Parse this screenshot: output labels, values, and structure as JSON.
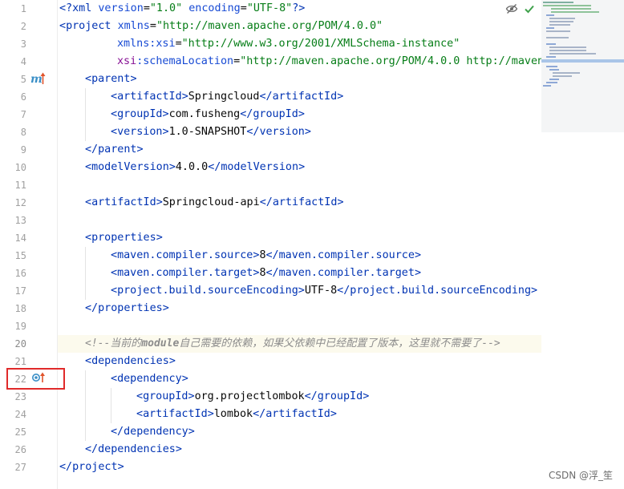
{
  "editor": {
    "line_numbers": [
      "1",
      "2",
      "3",
      "4",
      "5",
      "6",
      "7",
      "8",
      "9",
      "10",
      "11",
      "12",
      "13",
      "14",
      "15",
      "16",
      "17",
      "18",
      "19",
      "20",
      "21",
      "22",
      "23",
      "24",
      "25",
      "26",
      "27"
    ],
    "lines": {
      "l1": {
        "a": "<?",
        "b": "xml ",
        "c": "version",
        "d": "=",
        "e": "\"1.0\"",
        "f": " ",
        "g": "encoding",
        "h": "=",
        "i": "\"UTF-8\"",
        "j": "?>"
      },
      "l2": {
        "a": "<",
        "b": "project ",
        "c": "xmlns",
        "d": "=",
        "e": "\"http://maven.apache.org/POM/4.0.0\""
      },
      "l3": {
        "a": "xmlns:xsi",
        "b": "=",
        "c": "\"http://www.w3.org/2001/XMLSchema-instance\""
      },
      "l4": {
        "a": "xsi",
        "b": ":schemaLocation",
        "c": "=",
        "d": "\"http://maven.apache.org/POM/4.0.0 http://maven"
      },
      "l5": {
        "a": "<",
        "b": "parent",
        "c": ">"
      },
      "l6": {
        "a": "<",
        "b": "artifactId",
        "c": ">",
        "d": "Springcloud",
        "e": "</",
        "f": "artifactId",
        "g": ">"
      },
      "l7": {
        "a": "<",
        "b": "groupId",
        "c": ">",
        "d": "com.fusheng",
        "e": "</",
        "f": "groupId",
        "g": ">"
      },
      "l8": {
        "a": "<",
        "b": "version",
        "c": ">",
        "d": "1.0-SNAPSHOT",
        "e": "</",
        "f": "version",
        "g": ">"
      },
      "l9": {
        "a": "</",
        "b": "parent",
        "c": ">"
      },
      "l10": {
        "a": "<",
        "b": "modelVersion",
        "c": ">",
        "d": "4.0.0",
        "e": "</",
        "f": "modelVersion",
        "g": ">"
      },
      "l12": {
        "a": "<",
        "b": "artifactId",
        "c": ">",
        "d": "Springcloud-api",
        "e": "</",
        "f": "artifactId",
        "g": ">"
      },
      "l14": {
        "a": "<",
        "b": "properties",
        "c": ">"
      },
      "l15": {
        "a": "<",
        "b": "maven.compiler.source",
        "c": ">",
        "d": "8",
        "e": "</",
        "f": "maven.compiler.source",
        "g": ">"
      },
      "l16": {
        "a": "<",
        "b": "maven.compiler.target",
        "c": ">",
        "d": "8",
        "e": "</",
        "f": "maven.compiler.target",
        "g": ">"
      },
      "l17": {
        "a": "<",
        "b": "project.build.sourceEncoding",
        "c": ">",
        "d": "UTF-8",
        "e": "</",
        "f": "project.build.sourceEncoding",
        "g": ">"
      },
      "l18": {
        "a": "</",
        "b": "properties",
        "c": ">"
      },
      "l20": {
        "a": "<!--当前的",
        "b": "module",
        "c": "自己需要的依赖，如果父依赖中已经配置了版本，这里就不需要了-->"
      },
      "l21": {
        "a": "<",
        "b": "dependencies",
        "c": ">"
      },
      "l22": {
        "a": "<",
        "b": "dependency",
        "c": ">"
      },
      "l23": {
        "a": "<",
        "b": "groupId",
        "c": ">",
        "d": "org.projectlombok",
        "e": "</",
        "f": "groupId",
        "g": ">"
      },
      "l24": {
        "a": "<",
        "b": "artifactId",
        "c": ">",
        "d": "lombok",
        "e": "</",
        "f": "artifactId",
        "g": ">"
      },
      "l25": {
        "a": "</",
        "b": "dependency",
        "c": ">"
      },
      "l26": {
        "a": "</",
        "b": "dependencies",
        "c": ">"
      },
      "l27": {
        "a": "</",
        "b": "project",
        "c": ">"
      }
    },
    "gutter_icons": {
      "line5": "maven-parent-icon",
      "line22": "dependency-override-icon"
    }
  },
  "toolbar": {
    "reader_mode_icon": "eye-slash-icon",
    "inspection_status_icon": "check-icon"
  },
  "watermark": "CSDN @浮_笙",
  "colors": {
    "tag": "#0033b3",
    "attr_name": "#174ad4",
    "attr_value": "#067d17",
    "comment": "#8c8c8c",
    "highlight": "#fcfaed",
    "red_box": "#e02a2a"
  }
}
